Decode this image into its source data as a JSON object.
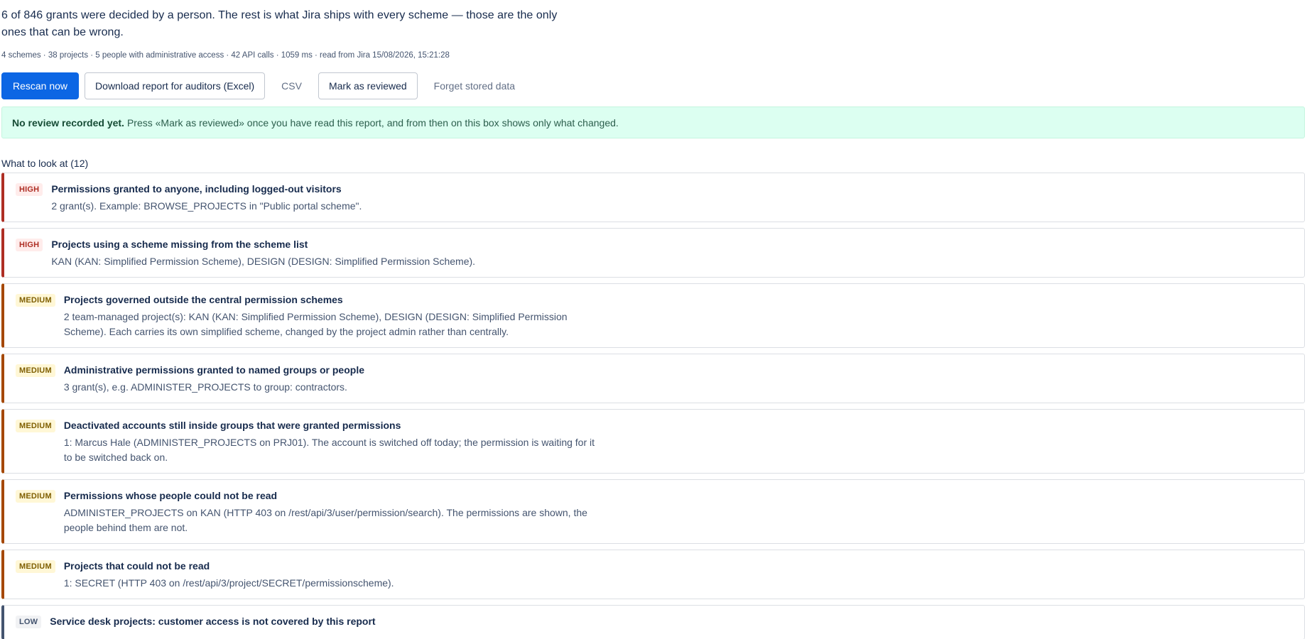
{
  "header": {
    "headline": "6 of 846 grants were decided by a person. The rest is what Jira ships with every scheme — those are the only ones that can be wrong.",
    "meta": "4 schemes · 38 projects · 5 people with administrative access · 42 API calls · 1059 ms · read from Jira 15/08/2026, 15:21:28"
  },
  "toolbar": {
    "rescan_label": "Rescan now",
    "download_label": "Download report for auditors (Excel)",
    "csv_label": "CSV",
    "mark_reviewed_label": "Mark as reviewed",
    "forget_label": "Forget stored data"
  },
  "notice": {
    "strong": "No review recorded yet.",
    "text": "Press «Mark as reviewed» once you have read this report, and from then on this box shows only what changed."
  },
  "findings_section": {
    "title": "What to look at (12)",
    "items": [
      {
        "severity": "HIGH",
        "title": "Permissions granted to anyone, including logged-out visitors",
        "detail": "2 grant(s). Example: BROWSE_PROJECTS in \"Public portal scheme\"."
      },
      {
        "severity": "HIGH",
        "title": "Projects using a scheme missing from the scheme list",
        "detail": "KAN (KAN: Simplified Permission Scheme), DESIGN (DESIGN: Simplified Permission Scheme)."
      },
      {
        "severity": "MEDIUM",
        "title": "Projects governed outside the central permission schemes",
        "detail": "2 team-managed project(s): KAN (KAN: Simplified Permission Scheme), DESIGN (DESIGN: Simplified Permission Scheme). Each carries its own simplified scheme, changed by the project admin rather than centrally."
      },
      {
        "severity": "MEDIUM",
        "title": "Administrative permissions granted to named groups or people",
        "detail": "3 grant(s), e.g. ADMINISTER_PROJECTS to group: contractors."
      },
      {
        "severity": "MEDIUM",
        "title": "Deactivated accounts still inside groups that were granted permissions",
        "detail": "1: Marcus Hale (ADMINISTER_PROJECTS on PRJ01). The account is switched off today; the permission is waiting for it to be switched back on."
      },
      {
        "severity": "MEDIUM",
        "title": "Permissions whose people could not be read",
        "detail": "ADMINISTER_PROJECTS on KAN (HTTP 403 on /rest/api/3/user/permission/search). The permissions are shown, the people behind them are not."
      },
      {
        "severity": "MEDIUM",
        "title": "Projects that could not be read",
        "detail": "1: SECRET (HTTP 403 on /rest/api/3/project/SECRET/permissionscheme)."
      },
      {
        "severity": "LOW",
        "title": "Service desk projects: customer access is not covered by this report",
        "detail": ""
      }
    ]
  },
  "colors": {
    "primary": "#0c66e4",
    "high": "#ae2e24",
    "medium": "#a54800",
    "low": "#44546f",
    "notice_bg": "#dcfff1"
  }
}
